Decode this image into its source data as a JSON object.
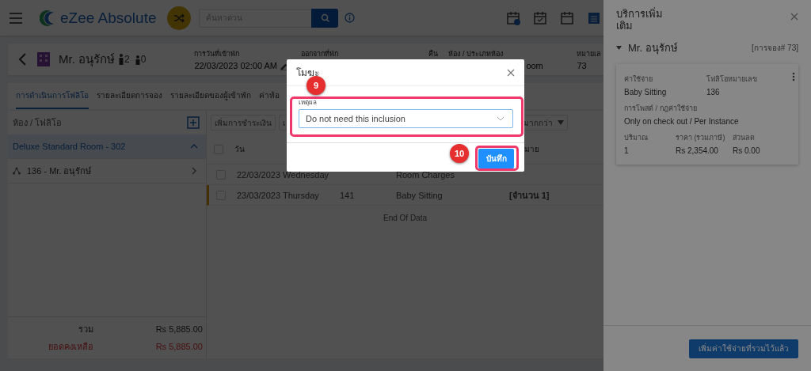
{
  "topbar": {
    "brand": "eZee Absolute",
    "search": {
      "placeholder": "ค้นหาด่วน"
    }
  },
  "guest": {
    "name": "Mr. อนุรักษ์",
    "adults": "2",
    "children": "0",
    "fields": [
      {
        "label": "การวันที่เข้าพัก",
        "value": "22/03/2023 02:00 AM",
        "editable": true
      },
      {
        "label": "ออกจากที่พัก",
        "editable": false
      },
      {
        "label": "คืน",
        "editable": false
      },
      {
        "label": "ห้อง / ประเภทห้อง",
        "value": "oom",
        "editable": false
      },
      {
        "label": "หมายเล",
        "value": "73",
        "editable": false
      }
    ]
  },
  "tabs": [
    {
      "label": "การดำเนินการโฟลิโอ",
      "selected": true
    },
    {
      "label": "รายละเอียดการจอง",
      "selected": false
    },
    {
      "label": "รายละเอียดของผู้เข้าพัก",
      "selected": false
    },
    {
      "label": "ค่าห้อ",
      "selected": false
    }
  ],
  "folio_panel": {
    "title": "ห้อง / โฟลิโอ",
    "items": [
      {
        "label": "Deluxe Standard Room - 302",
        "kind": "room",
        "expanded": true
      },
      {
        "label": "136 - Mr. อนุรักษ์",
        "kind": "folio",
        "expanded": false
      }
    ],
    "totals": [
      {
        "label": "รวม",
        "value": "Rs 5,885.00",
        "kind": "total"
      },
      {
        "label": "ยอดคงเหลือ",
        "value": "Rs 5,885.00",
        "kind": "balance"
      }
    ]
  },
  "toolbar": {
    "buttons": [
      "เพิ่มการชำระเงิน",
      "เ"
    ],
    "more": "มากกว่า"
  },
  "table": {
    "select_all_checked": false,
    "columns": [
      "วัน",
      "มาย"
    ],
    "rows": [
      {
        "date": "22/03/2023 Wednesday",
        "item": "Room Charges",
        "checked": false,
        "flagged": false
      },
      {
        "date": "23/03/2023 Thursday",
        "number": "141",
        "item": "Baby Sitting",
        "note": "[จำนวน 1]",
        "checked": false,
        "flagged": true
      }
    ],
    "footer": "End Of Data"
  },
  "drawer": {
    "title": "บริการเพิ่ม เติม",
    "guest": "Mr. อนุรักษ์",
    "booking": "[การจอง# 73]",
    "card": [
      {
        "label": "ค่าใช้จ่าย",
        "value": "Baby Sitting"
      },
      {
        "label": "โฟลิโอหมายเลข",
        "value": "136"
      },
      {
        "label": "การโพสต์ / กฎค่าใช้จ่าย",
        "value": "Only on check out / Per Instance"
      },
      {
        "label": "ปริมาณ",
        "value": "1"
      },
      {
        "label": "ราคา (รวมภาษี)",
        "value": "Rs 2,354.00"
      },
      {
        "label": "ส่วนลด",
        "value": "Rs 0.00"
      }
    ],
    "button": "เพิ่มค่าใช้จ่ายที่รวมไว้แล้ว"
  },
  "modal": {
    "title": "โมฆะ",
    "field_label": "เหตุผล",
    "field_value": "Do not need this inclusion",
    "button": "บันทึก"
  },
  "annotations": [
    {
      "number": "9",
      "kind": "field"
    },
    {
      "number": "10",
      "kind": "button"
    }
  ]
}
